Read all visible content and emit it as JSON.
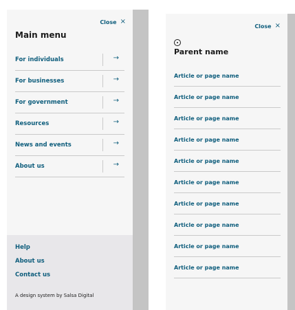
{
  "left_panel": {
    "close_label": "Close",
    "close_icon": "×",
    "title": "Main menu",
    "items": [
      {
        "label": "For individuals",
        "arrow": "→"
      },
      {
        "label": "For businesses",
        "arrow": "→"
      },
      {
        "label": "For government",
        "arrow": "→"
      },
      {
        "label": "Resources",
        "arrow": "→"
      },
      {
        "label": "News and events",
        "arrow": "→"
      },
      {
        "label": "About us",
        "arrow": "→"
      }
    ],
    "footer": {
      "links": [
        "Help",
        "About us",
        "Contact us"
      ],
      "note": "A design system by Salsa Digital"
    }
  },
  "right_panel": {
    "close_label": "Close",
    "close_icon": "×",
    "title": "Parent name",
    "items": [
      "Article or page name",
      "Article or page name",
      "Article or page name",
      "Article or page name",
      "Article or page name",
      "Article or page name",
      "Article or page name",
      "Article or page name",
      "Article or page name",
      "Article or page name"
    ]
  }
}
